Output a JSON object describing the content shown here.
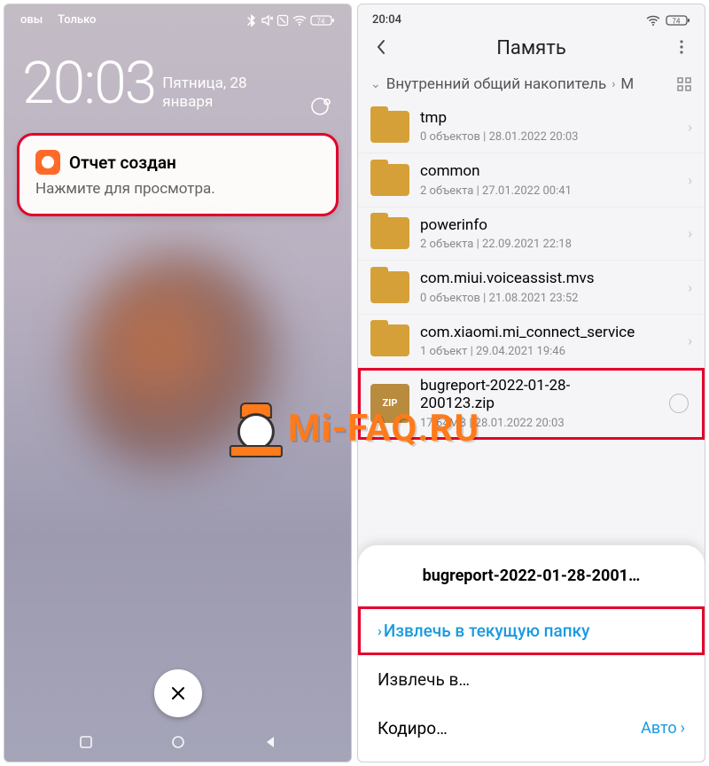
{
  "watermark": "Mi-FAQ.RU",
  "left": {
    "status": {
      "carrier1": "овы",
      "carrier2": "Только",
      "battery": "74"
    },
    "clock": {
      "time": "20:03",
      "date": "Пятница, 28 января"
    },
    "notification": {
      "title": "Отчет создан",
      "body": "Нажмите для просмотра."
    }
  },
  "right": {
    "status": {
      "time": "20:04",
      "battery": "74"
    },
    "header": {
      "title": "Память",
      "breadcrumb": "Внутренний общий накопитель",
      "crumb_trunc": "M"
    },
    "items": [
      {
        "name": "tmp",
        "meta": "0 объектов | 28.01.2022 20:03",
        "type": "folder"
      },
      {
        "name": "common",
        "meta": "2 объекта | 27.01.2022 00:41",
        "type": "folder"
      },
      {
        "name": "powerinfo",
        "meta": "2 объекта | 22.09.2021 22:18",
        "type": "folder"
      },
      {
        "name": "com.miui.voiceassist.mvs",
        "meta": "0 объектов | 21.08.2021 23:52",
        "type": "folder"
      },
      {
        "name": "com.xiaomi.mi_connect_service",
        "meta": "1 объект | 29.04.2021 19:46",
        "type": "folder"
      },
      {
        "name": "bugreport-2022-01-28-200123.zip",
        "meta": "17.64MB | 28.01.2022 20:03",
        "type": "zip",
        "highlight": true,
        "selectable": true
      }
    ],
    "sheet": {
      "title": "bugreport-2022-01-28-2001…",
      "extract_here": "Извлечь в текущую папку",
      "extract_to": "Извлечь в…",
      "encoding_label": "Кодиро…",
      "encoding_value": "Авто"
    }
  }
}
